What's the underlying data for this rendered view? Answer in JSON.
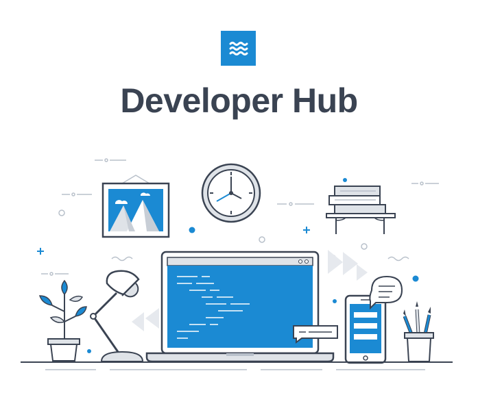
{
  "header": {
    "logo_icon": "waves-icon",
    "title": "Developer Hub"
  },
  "illustration": {
    "elements": [
      "picture-frame-icon",
      "wall-clock-icon",
      "stacked-books-icon",
      "shelf-icon",
      "plant-icon",
      "desk-lamp-icon",
      "laptop-icon",
      "code-editor-icon",
      "chat-bubble-icon",
      "smartphone-icon",
      "pencil-cup-icon"
    ]
  },
  "colors": {
    "accent": "#1b8ad3",
    "outline": "#3a4352",
    "light_gray": "#dfe3e8",
    "mid_gray": "#b8c0ca"
  }
}
